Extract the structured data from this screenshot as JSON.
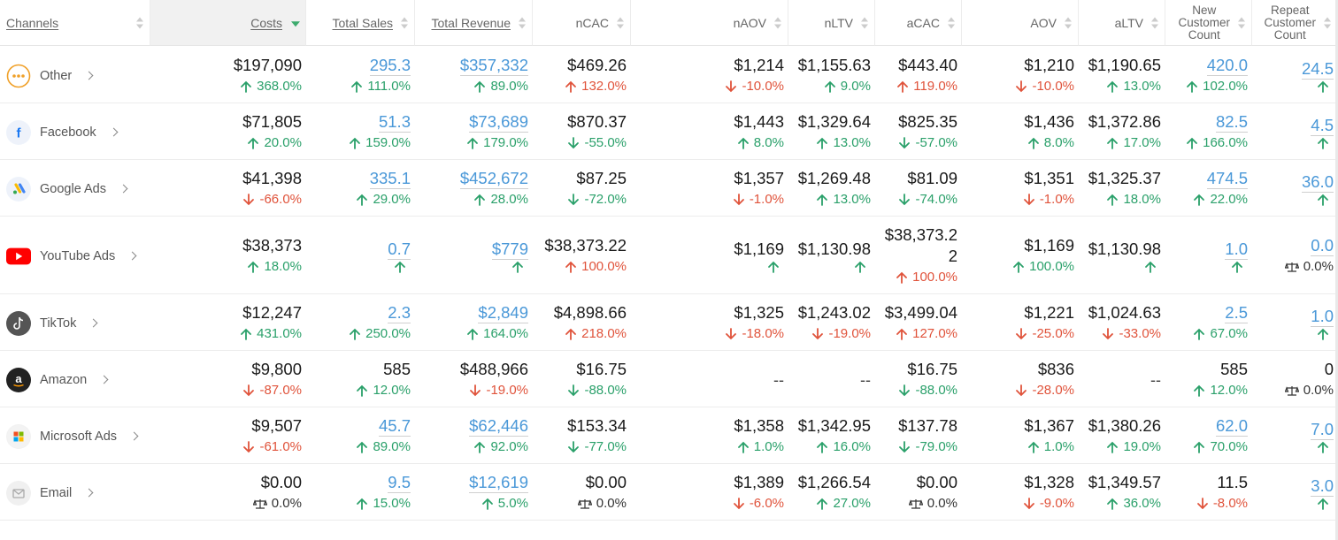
{
  "columns": [
    {
      "key": "channels",
      "label": "Channels",
      "underline": true
    },
    {
      "key": "costs",
      "label": "Costs",
      "underline": true,
      "sorted": true
    },
    {
      "key": "total_sales",
      "label": "Total Sales",
      "underline": true
    },
    {
      "key": "total_revenue",
      "label": "Total Revenue",
      "underline": true
    },
    {
      "key": "ncac",
      "label": "nCAC"
    },
    {
      "key": "naov",
      "label": "nAOV"
    },
    {
      "key": "nltv",
      "label": "nLTV"
    },
    {
      "key": "acac",
      "label": "aCAC"
    },
    {
      "key": "aov",
      "label": "AOV"
    },
    {
      "key": "altv",
      "label": "aLTV"
    },
    {
      "key": "new_customer_count",
      "label": "New Customer Count",
      "lines": [
        "New",
        "Customer",
        "Count"
      ]
    },
    {
      "key": "repeat_customer_count",
      "label": "Repeat Customer Count",
      "lines": [
        "Repeat",
        "Customer",
        "Count"
      ]
    }
  ],
  "rows": [
    {
      "channel": "Other",
      "icon": "more-dots-icon",
      "cells": [
        {
          "v": "$197,090",
          "d": "368.0%",
          "t": "up"
        },
        {
          "v": "295.3",
          "d": "111.0%",
          "t": "up",
          "link": true
        },
        {
          "v": "$357,332",
          "d": "89.0%",
          "t": "up",
          "link": true
        },
        {
          "v": "$469.26",
          "d": "132.0%",
          "t": "up-bad"
        },
        {
          "v": "$1,214",
          "d": "-10.0%",
          "t": "down"
        },
        {
          "v": "$1,155.63",
          "d": "9.0%",
          "t": "up"
        },
        {
          "v": "$443.40",
          "d": "119.0%",
          "t": "up-bad"
        },
        {
          "v": "$1,210",
          "d": "-10.0%",
          "t": "down"
        },
        {
          "v": "$1,190.65",
          "d": "13.0%",
          "t": "up"
        },
        {
          "v": "420.0",
          "d": "102.0%",
          "t": "up",
          "link": true
        },
        {
          "v": "24.5",
          "d": "",
          "t": "up",
          "link": true
        }
      ]
    },
    {
      "channel": "Facebook",
      "icon": "facebook-icon",
      "cells": [
        {
          "v": "$71,805",
          "d": "20.0%",
          "t": "up"
        },
        {
          "v": "51.3",
          "d": "159.0%",
          "t": "up",
          "link": true
        },
        {
          "v": "$73,689",
          "d": "179.0%",
          "t": "up",
          "link": true
        },
        {
          "v": "$870.37",
          "d": "-55.0%",
          "t": "down-good"
        },
        {
          "v": "$1,443",
          "d": "8.0%",
          "t": "up"
        },
        {
          "v": "$1,329.64",
          "d": "13.0%",
          "t": "up"
        },
        {
          "v": "$825.35",
          "d": "-57.0%",
          "t": "down-good"
        },
        {
          "v": "$1,436",
          "d": "8.0%",
          "t": "up"
        },
        {
          "v": "$1,372.86",
          "d": "17.0%",
          "t": "up"
        },
        {
          "v": "82.5",
          "d": "166.0%",
          "t": "up",
          "link": true
        },
        {
          "v": "4.5",
          "d": "",
          "t": "up",
          "link": true
        }
      ]
    },
    {
      "channel": "Google Ads",
      "icon": "google-ads-icon",
      "cells": [
        {
          "v": "$41,398",
          "d": "-66.0%",
          "t": "down"
        },
        {
          "v": "335.1",
          "d": "29.0%",
          "t": "up",
          "link": true
        },
        {
          "v": "$452,672",
          "d": "28.0%",
          "t": "up",
          "link": true
        },
        {
          "v": "$87.25",
          "d": "-72.0%",
          "t": "down-good"
        },
        {
          "v": "$1,357",
          "d": "-1.0%",
          "t": "down"
        },
        {
          "v": "$1,269.48",
          "d": "13.0%",
          "t": "up"
        },
        {
          "v": "$81.09",
          "d": "-74.0%",
          "t": "down-good"
        },
        {
          "v": "$1,351",
          "d": "-1.0%",
          "t": "down"
        },
        {
          "v": "$1,325.37",
          "d": "18.0%",
          "t": "up"
        },
        {
          "v": "474.5",
          "d": "22.0%",
          "t": "up",
          "link": true
        },
        {
          "v": "36.0",
          "d": "",
          "t": "up",
          "link": true
        }
      ]
    },
    {
      "channel": "YouTube Ads",
      "icon": "youtube-icon",
      "cells": [
        {
          "v": "$38,373",
          "d": "18.0%",
          "t": "up"
        },
        {
          "v": "0.7",
          "d": "",
          "t": "up",
          "link": true
        },
        {
          "v": "$779",
          "d": "",
          "t": "up",
          "link": true
        },
        {
          "v": "$38,373.22",
          "d": "100.0%",
          "t": "up-bad"
        },
        {
          "v": "$1,169",
          "d": "",
          "t": "up"
        },
        {
          "v": "$1,130.98",
          "d": "",
          "t": "up"
        },
        {
          "v": "$38,373.22",
          "d": "100.0%",
          "t": "up-bad",
          "wrap": true
        },
        {
          "v": "$1,169",
          "d": "100.0%",
          "t": "up"
        },
        {
          "v": "$1,130.98",
          "d": "",
          "t": "up"
        },
        {
          "v": "1.0",
          "d": "",
          "t": "up",
          "link": true
        },
        {
          "v": "0.0",
          "d": "0.0%",
          "t": "flat",
          "link": true
        }
      ]
    },
    {
      "channel": "TikTok",
      "icon": "tiktok-icon",
      "cells": [
        {
          "v": "$12,247",
          "d": "431.0%",
          "t": "up"
        },
        {
          "v": "2.3",
          "d": "250.0%",
          "t": "up",
          "link": true
        },
        {
          "v": "$2,849",
          "d": "164.0%",
          "t": "up",
          "link": true
        },
        {
          "v": "$4,898.66",
          "d": "218.0%",
          "t": "up-bad"
        },
        {
          "v": "$1,325",
          "d": "-18.0%",
          "t": "down"
        },
        {
          "v": "$1,243.02",
          "d": "-19.0%",
          "t": "down"
        },
        {
          "v": "$3,499.04",
          "d": "127.0%",
          "t": "up-bad"
        },
        {
          "v": "$1,221",
          "d": "-25.0%",
          "t": "down"
        },
        {
          "v": "$1,024.63",
          "d": "-33.0%",
          "t": "down"
        },
        {
          "v": "2.5",
          "d": "67.0%",
          "t": "up",
          "link": true
        },
        {
          "v": "1.0",
          "d": "",
          "t": "up",
          "link": true
        }
      ]
    },
    {
      "channel": "Amazon",
      "icon": "amazon-icon",
      "cells": [
        {
          "v": "$9,800",
          "d": "-87.0%",
          "t": "down"
        },
        {
          "v": "585",
          "d": "12.0%",
          "t": "up"
        },
        {
          "v": "$488,966",
          "d": "-19.0%",
          "t": "down"
        },
        {
          "v": "$16.75",
          "d": "-88.0%",
          "t": "down-good"
        },
        {
          "v": "--",
          "d": "",
          "t": "none",
          "dash": true
        },
        {
          "v": "--",
          "d": "",
          "t": "none",
          "dash": true
        },
        {
          "v": "$16.75",
          "d": "-88.0%",
          "t": "down-good"
        },
        {
          "v": "$836",
          "d": "-28.0%",
          "t": "down"
        },
        {
          "v": "--",
          "d": "",
          "t": "none",
          "dash": true
        },
        {
          "v": "585",
          "d": "12.0%",
          "t": "up"
        },
        {
          "v": "0",
          "d": "0.0%",
          "t": "flat"
        }
      ]
    },
    {
      "channel": "Microsoft Ads",
      "icon": "microsoft-icon",
      "cells": [
        {
          "v": "$9,507",
          "d": "-61.0%",
          "t": "down"
        },
        {
          "v": "45.7",
          "d": "89.0%",
          "t": "up",
          "link": true
        },
        {
          "v": "$62,446",
          "d": "92.0%",
          "t": "up",
          "link": true
        },
        {
          "v": "$153.34",
          "d": "-77.0%",
          "t": "down-good"
        },
        {
          "v": "$1,358",
          "d": "1.0%",
          "t": "up"
        },
        {
          "v": "$1,342.95",
          "d": "16.0%",
          "t": "up"
        },
        {
          "v": "$137.78",
          "d": "-79.0%",
          "t": "down-good"
        },
        {
          "v": "$1,367",
          "d": "1.0%",
          "t": "up"
        },
        {
          "v": "$1,380.26",
          "d": "19.0%",
          "t": "up"
        },
        {
          "v": "62.0",
          "d": "70.0%",
          "t": "up",
          "link": true
        },
        {
          "v": "7.0",
          "d": "",
          "t": "up",
          "link": true
        }
      ]
    },
    {
      "channel": "Email",
      "icon": "email-icon",
      "cells": [
        {
          "v": "$0.00",
          "d": "0.0%",
          "t": "flat"
        },
        {
          "v": "9.5",
          "d": "15.0%",
          "t": "up",
          "link": true
        },
        {
          "v": "$12,619",
          "d": "5.0%",
          "t": "up",
          "link": true
        },
        {
          "v": "$0.00",
          "d": "0.0%",
          "t": "flat"
        },
        {
          "v": "$1,389",
          "d": "-6.0%",
          "t": "down"
        },
        {
          "v": "$1,266.54",
          "d": "27.0%",
          "t": "up"
        },
        {
          "v": "$0.00",
          "d": "0.0%",
          "t": "flat"
        },
        {
          "v": "$1,328",
          "d": "-9.0%",
          "t": "down"
        },
        {
          "v": "$1,349.57",
          "d": "36.0%",
          "t": "up"
        },
        {
          "v": "11.5",
          "d": "-8.0%",
          "t": "down"
        },
        {
          "v": "3.0",
          "d": "",
          "t": "up",
          "link": true
        }
      ]
    }
  ],
  "colors": {
    "up": "#2aa06a",
    "down": "#e0533b",
    "link": "#4a98d8",
    "sort_active": "#3dab6e"
  }
}
